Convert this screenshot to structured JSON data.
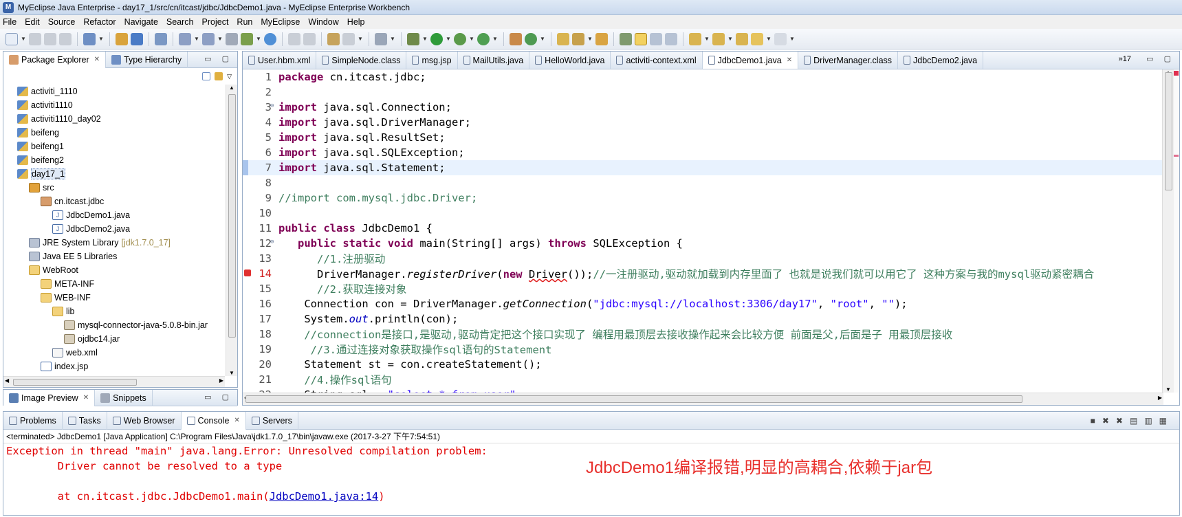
{
  "window": {
    "title": "MyEclipse Java Enterprise - day17_1/src/cn/itcast/jdbc/JdbcDemo1.java - MyEclipse Enterprise Workbench"
  },
  "menu": [
    "File",
    "Edit",
    "Source",
    "Refactor",
    "Navigate",
    "Search",
    "Project",
    "Run",
    "MyEclipse",
    "Window",
    "Help"
  ],
  "package_explorer": {
    "tab_label": "Package Explorer",
    "tab2_label": "Type Hierarchy",
    "items": [
      {
        "label": "activiti_1110",
        "indent": 0,
        "icon": "project-icon"
      },
      {
        "label": "activiti1110",
        "indent": 0,
        "icon": "project-icon"
      },
      {
        "label": "activiti1110_day02",
        "indent": 0,
        "icon": "project-icon"
      },
      {
        "label": "beifeng",
        "indent": 0,
        "icon": "project-icon"
      },
      {
        "label": "beifeng1",
        "indent": 0,
        "icon": "project-icon"
      },
      {
        "label": "beifeng2",
        "indent": 0,
        "icon": "project-icon"
      },
      {
        "label": "day17_1",
        "indent": 0,
        "icon": "project-icon",
        "selected": true
      },
      {
        "label": "src",
        "indent": 1,
        "icon": "source-folder-icon"
      },
      {
        "label": "cn.itcast.jdbc",
        "indent": 2,
        "icon": "package-icon"
      },
      {
        "label": "JdbcDemo1.java",
        "indent": 3,
        "icon": "java-file-icon"
      },
      {
        "label": "JdbcDemo2.java",
        "indent": 3,
        "icon": "java-file-icon"
      },
      {
        "label": "JRE System Library",
        "indent": 1,
        "icon": "library-icon",
        "decoration": "[jdk1.7.0_17]"
      },
      {
        "label": "Java EE 5 Libraries",
        "indent": 1,
        "icon": "library-icon"
      },
      {
        "label": "WebRoot",
        "indent": 1,
        "icon": "folder-icon"
      },
      {
        "label": "META-INF",
        "indent": 2,
        "icon": "folder-icon"
      },
      {
        "label": "WEB-INF",
        "indent": 2,
        "icon": "folder-icon"
      },
      {
        "label": "lib",
        "indent": 3,
        "icon": "folder-icon"
      },
      {
        "label": "mysql-connector-java-5.0.8-bin.jar",
        "indent": 4,
        "icon": "jar-icon"
      },
      {
        "label": "ojdbc14.jar",
        "indent": 4,
        "icon": "jar-icon"
      },
      {
        "label": "web.xml",
        "indent": 3,
        "icon": "xml-file-icon"
      },
      {
        "label": "index.jsp",
        "indent": 2,
        "icon": "jsp-file-icon"
      }
    ]
  },
  "image_preview": {
    "tab_label": "Image Preview",
    "tab2_label": "Snippets"
  },
  "editor": {
    "tabs": [
      "User.hbm.xml",
      "SimpleNode.class",
      "msg.jsp",
      "MailUtils.java",
      "HelloWorld.java",
      "activiti-context.xml",
      "JdbcDemo1.java",
      "DriverManager.class",
      "JdbcDemo2.java"
    ],
    "active_tab": "JdbcDemo1.java",
    "overflow_count": "17",
    "lines": [
      {
        "n": "1",
        "parts": [
          {
            "t": "package",
            "c": "kw"
          },
          {
            "t": " cn.itcast.jdbc;"
          }
        ]
      },
      {
        "n": "2",
        "parts": []
      },
      {
        "n": "3",
        "parts": [
          {
            "t": "import",
            "c": "kw"
          },
          {
            "t": " java.sql.Connection;"
          }
        ],
        "fold": true
      },
      {
        "n": "4",
        "parts": [
          {
            "t": "import",
            "c": "kw"
          },
          {
            "t": " java.sql.DriverManager;"
          }
        ]
      },
      {
        "n": "5",
        "parts": [
          {
            "t": "import",
            "c": "kw"
          },
          {
            "t": " java.sql.ResultSet;"
          }
        ]
      },
      {
        "n": "6",
        "parts": [
          {
            "t": "import",
            "c": "kw"
          },
          {
            "t": " java.sql.SQLException;"
          }
        ]
      },
      {
        "n": "7",
        "parts": [
          {
            "t": "import",
            "c": "kw"
          },
          {
            "t": " java.sql.Statement;"
          }
        ],
        "current": true
      },
      {
        "n": "8",
        "parts": []
      },
      {
        "n": "9",
        "parts": [
          {
            "t": "//import com.mysql.jdbc.Driver;",
            "c": "cm"
          }
        ]
      },
      {
        "n": "10",
        "parts": []
      },
      {
        "n": "11",
        "parts": [
          {
            "t": "public",
            "c": "kw"
          },
          {
            "t": " "
          },
          {
            "t": "class",
            "c": "kw"
          },
          {
            "t": " JdbcDemo1 {"
          }
        ]
      },
      {
        "n": "12",
        "parts": [
          {
            "t": "   "
          },
          {
            "t": "public",
            "c": "kw"
          },
          {
            "t": " "
          },
          {
            "t": "static",
            "c": "kw"
          },
          {
            "t": " "
          },
          {
            "t": "void",
            "c": "kw"
          },
          {
            "t": " main(String[] args) "
          },
          {
            "t": "throws",
            "c": "kw"
          },
          {
            "t": " SQLException {"
          }
        ],
        "fold": true
      },
      {
        "n": "13",
        "parts": [
          {
            "t": "      //1.注册驱动",
            "c": "cm"
          }
        ]
      },
      {
        "n": "14",
        "parts": [
          {
            "t": "      DriverManager."
          },
          {
            "t": "registerDriver",
            "c": "it"
          },
          {
            "t": "("
          },
          {
            "t": "new",
            "c": "kw"
          },
          {
            "t": " "
          },
          {
            "t": "Driver",
            "c": "err"
          },
          {
            "t": "());"
          },
          {
            "t": "//一注册驱动,驱动就加载到内存里面了 也就是说我们就可以用它了 这种方案与我的mysql驱动紧密耦合",
            "c": "cm"
          }
        ],
        "error": true
      },
      {
        "n": "15",
        "parts": [
          {
            "t": "      //2.获取连接对象",
            "c": "cm"
          }
        ]
      },
      {
        "n": "16",
        "parts": [
          {
            "t": "    Connection con = DriverManager."
          },
          {
            "t": "getConnection",
            "c": "it"
          },
          {
            "t": "("
          },
          {
            "t": "\"jdbc:mysql://localhost:3306/day17\"",
            "c": "str"
          },
          {
            "t": ", "
          },
          {
            "t": "\"root\"",
            "c": "str"
          },
          {
            "t": ", "
          },
          {
            "t": "\"\"",
            "c": "str"
          },
          {
            "t": ");"
          }
        ]
      },
      {
        "n": "17",
        "parts": [
          {
            "t": "    System."
          },
          {
            "t": "out",
            "c": "fld"
          },
          {
            "t": ".println(con);"
          }
        ]
      },
      {
        "n": "18",
        "parts": [
          {
            "t": "    //connection是接口,是驱动,驱动肯定把这个接口实现了 编程用最顶层去接收操作起来会比较方便 前面是父,后面是子 用最顶层接收",
            "c": "cm"
          }
        ]
      },
      {
        "n": "19",
        "parts": [
          {
            "t": "     //3.通过连接对象获取操作sql语句的Statement",
            "c": "cm"
          }
        ]
      },
      {
        "n": "20",
        "parts": [
          {
            "t": "    Statement st = con.createStatement();"
          }
        ]
      },
      {
        "n": "21",
        "parts": [
          {
            "t": "    //4.操作sql语句",
            "c": "cm"
          }
        ]
      },
      {
        "n": "22",
        "parts": [
          {
            "t": "    String sql = "
          },
          {
            "t": "\"select * from user\"",
            "c": "str"
          },
          {
            "t": ";"
          }
        ]
      }
    ]
  },
  "bottom": {
    "tabs": [
      "Problems",
      "Tasks",
      "Web Browser",
      "Console",
      "Servers"
    ],
    "active_tab": "Console",
    "terminated": "<terminated> JdbcDemo1 [Java Application] C:\\Program Files\\Java\\jdk1.7.0_17\\bin\\javaw.exe (2017-3-27 下午7:54:51)",
    "console_line1": "Exception in thread \"main\" java.lang.Error: Unresolved compilation problem: ",
    "console_line2": "\tDriver cannot be resolved to a type",
    "console_line4_prefix": "\tat cn.itcast.jdbc.JdbcDemo1.main(",
    "console_link": "JdbcDemo1.java:14",
    "console_line4_suffix": ")"
  },
  "annotation": "JdbcDemo1编译报错,明显的高耦合,依赖于jar包",
  "colors": {
    "keyword": "#7f0055",
    "comment": "#3f7f5f",
    "string": "#2a00ff",
    "error": "#e00000",
    "annotation": "#e8302c"
  }
}
